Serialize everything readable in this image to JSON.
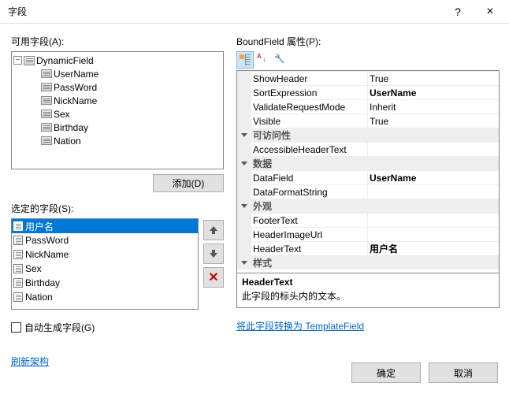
{
  "titlebar": {
    "title": "字段",
    "help": "?",
    "close": "×"
  },
  "left": {
    "available_label": "可用字段(A):",
    "tree": {
      "root": "DynamicField",
      "children": [
        "UserName",
        "PassWord",
        "NickName",
        "Sex",
        "Birthday",
        "Nation"
      ]
    },
    "add_btn": "添加(D)",
    "selected_label": "选定的字段(S):",
    "selected": [
      "用户名",
      "PassWord",
      "NickName",
      "Sex",
      "Birthday",
      "Nation"
    ],
    "auto_gen": "自动生成字段(G)",
    "refresh": "刷新架构"
  },
  "right": {
    "props_label": "BoundField 属性(P):",
    "rows": [
      {
        "type": "prop",
        "name": "ShowHeader",
        "value": "True",
        "bold": false
      },
      {
        "type": "prop",
        "name": "SortExpression",
        "value": "UserName",
        "bold": true
      },
      {
        "type": "prop",
        "name": "ValidateRequestMode",
        "value": "Inherit",
        "bold": false
      },
      {
        "type": "prop",
        "name": "Visible",
        "value": "True",
        "bold": false
      },
      {
        "type": "cat",
        "name": "可访问性"
      },
      {
        "type": "prop",
        "name": "AccessibleHeaderText",
        "value": "",
        "bold": false
      },
      {
        "type": "cat",
        "name": "数据"
      },
      {
        "type": "prop",
        "name": "DataField",
        "value": "UserName",
        "bold": true
      },
      {
        "type": "prop",
        "name": "DataFormatString",
        "value": "",
        "bold": false
      },
      {
        "type": "cat",
        "name": "外观"
      },
      {
        "type": "prop",
        "name": "FooterText",
        "value": "",
        "bold": false
      },
      {
        "type": "prop",
        "name": "HeaderImageUrl",
        "value": "",
        "bold": false
      },
      {
        "type": "prop",
        "name": "HeaderText",
        "value": "用户名",
        "bold": true
      },
      {
        "type": "cat",
        "name": "样式"
      }
    ],
    "desc_title": "HeaderText",
    "desc_text": "此字段的标头内的文本。",
    "convert": "将此字段转换为 TemplateField"
  },
  "buttons": {
    "ok": "确定",
    "cancel": "取消"
  }
}
